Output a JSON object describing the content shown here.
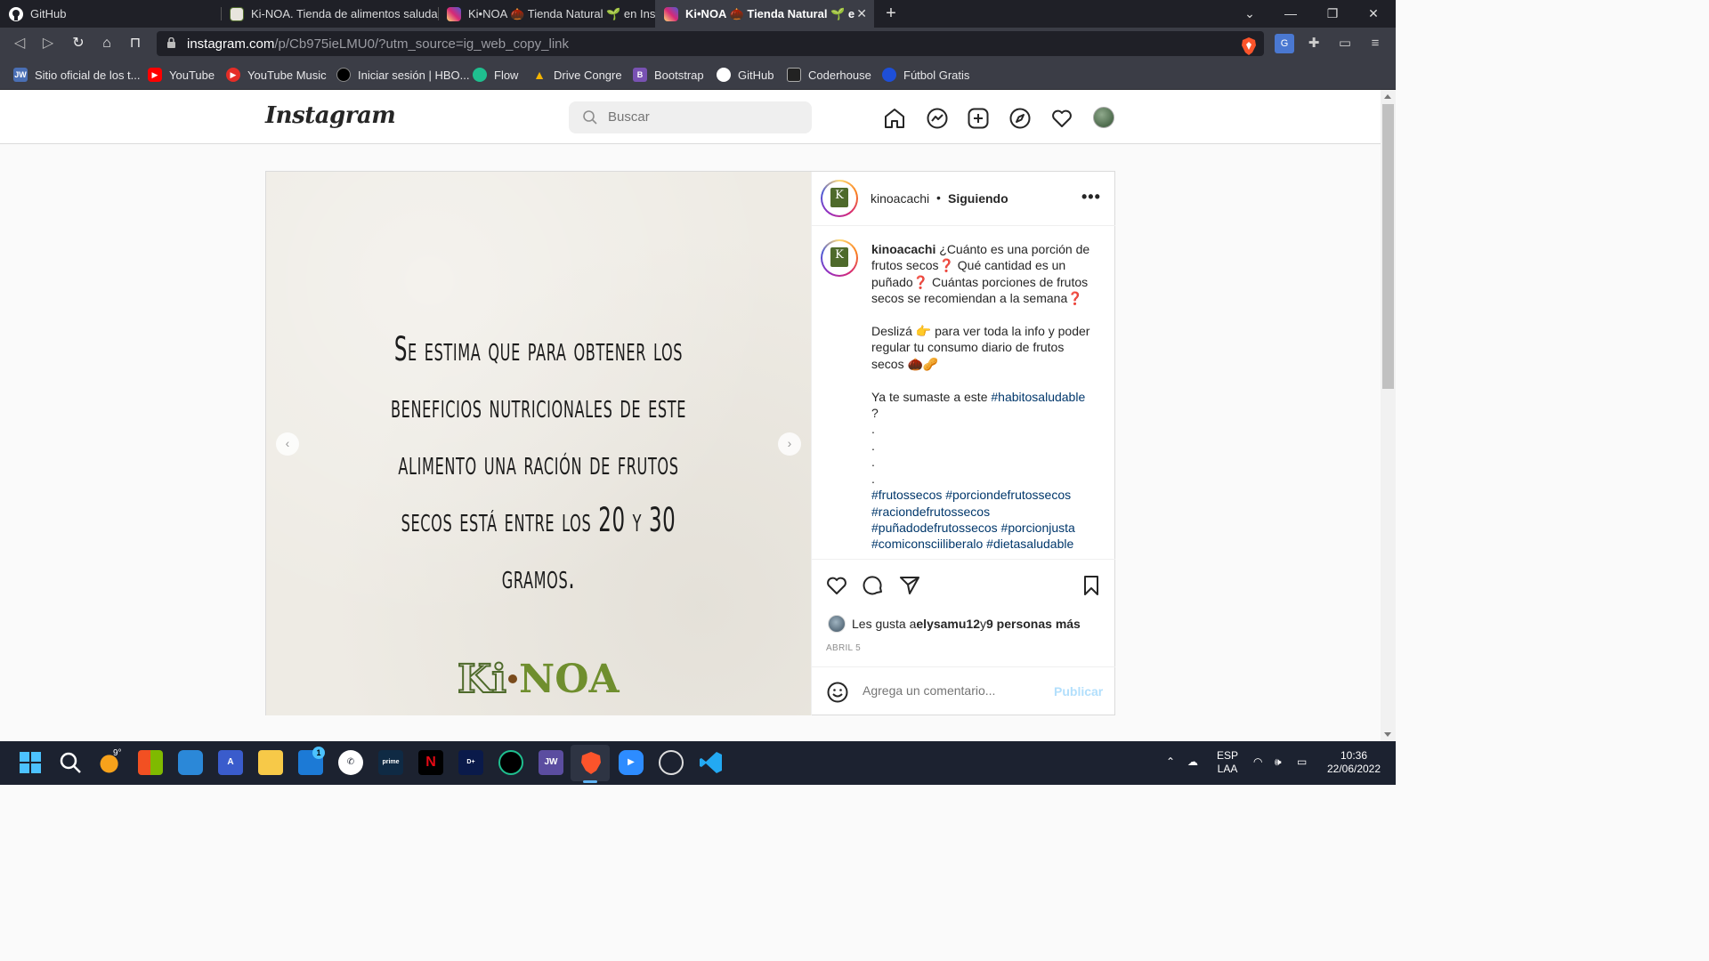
{
  "browser": {
    "tabs": [
      {
        "title": "GitHub",
        "active": false
      },
      {
        "title": "Ki-NOA. Tienda de alimentos saludabl",
        "active": false
      },
      {
        "title": "Ki•NOA 🌰 Tienda Natural 🌱 en Inst",
        "active": false
      },
      {
        "title": "Ki•NOA 🌰 Tienda Natural 🌱 en",
        "active": true
      }
    ],
    "url_host": "instagram.com",
    "url_path": "/p/Cb975ieLMU0/?utm_source=ig_web_copy_link",
    "bookmarks": [
      {
        "label": "Sitio oficial de los t...",
        "icon_text": "JW",
        "color": "#4a6fb5"
      },
      {
        "label": "YouTube",
        "icon_text": "▶",
        "color": "#ff0000"
      },
      {
        "label": "YouTube Music",
        "icon_text": "▶",
        "color": "#e52d27"
      },
      {
        "label": "Iniciar sesión | HBO...",
        "icon_text": "",
        "color": "#000000"
      },
      {
        "label": "Flow",
        "icon_text": "",
        "color": "#1fbf8f"
      },
      {
        "label": "Drive Congre",
        "icon_text": "▲",
        "color": "#f4b400"
      },
      {
        "label": "Bootstrap",
        "icon_text": "B",
        "color": "#7952b3"
      },
      {
        "label": "GitHub",
        "icon_text": "",
        "color": "#ffffff"
      },
      {
        "label": "Coderhouse",
        "icon_text": "",
        "color": "#222222"
      },
      {
        "label": "Fútbol Gratis",
        "icon_text": "",
        "color": "#1e4fd8"
      }
    ]
  },
  "instagram": {
    "logo": "Instagram",
    "search_placeholder": "Buscar",
    "post": {
      "image_text": "Se estima que para obtener los beneficios nutricionales de este alimento una ración de frutos secos está entre los 20 y 30 gramos.",
      "brand_logo": {
        "k": "Ki",
        "noa": "NOA"
      },
      "username": "kinoacachi",
      "separator": "•",
      "following_label": "Siguiendo",
      "caption_user": "kinoacachi",
      "caption_part1": " ¿Cuánto es una porción de frutos secos❓ Qué cantidad es un puñado❓ Cuántas porciones de frutos secos se recomiendan a la semana❓\n\nDeslizá 👉 para ver toda la info y poder regular tu consumo diario de frutos secos 🌰🥜\n\nYa te sumaste a este ",
      "caption_hashtag1": "#habitosaludable",
      "caption_part2": "\n?\n.\n.\n.\n.\n",
      "caption_hashtags": "#frutossecos #porciondefrutossecos #raciondefrutossecos #puñadodefrutossecos #porcionjusta #comiconsciiliberalo #dietasaludable",
      "likes_prefix": "Les gusta a ",
      "likes_user": "elysamu12",
      "likes_middle": " y ",
      "likes_others": "9 personas más",
      "date": "ABRIL 5",
      "comment_placeholder": "Agrega un comentario...",
      "publish_label": "Publicar"
    }
  },
  "taskbar": {
    "weather_temp": "9°",
    "mail_badge": "1",
    "lang_line1": "ESP",
    "lang_line2": "LAA",
    "time": "10:36",
    "date": "22/06/2022"
  }
}
